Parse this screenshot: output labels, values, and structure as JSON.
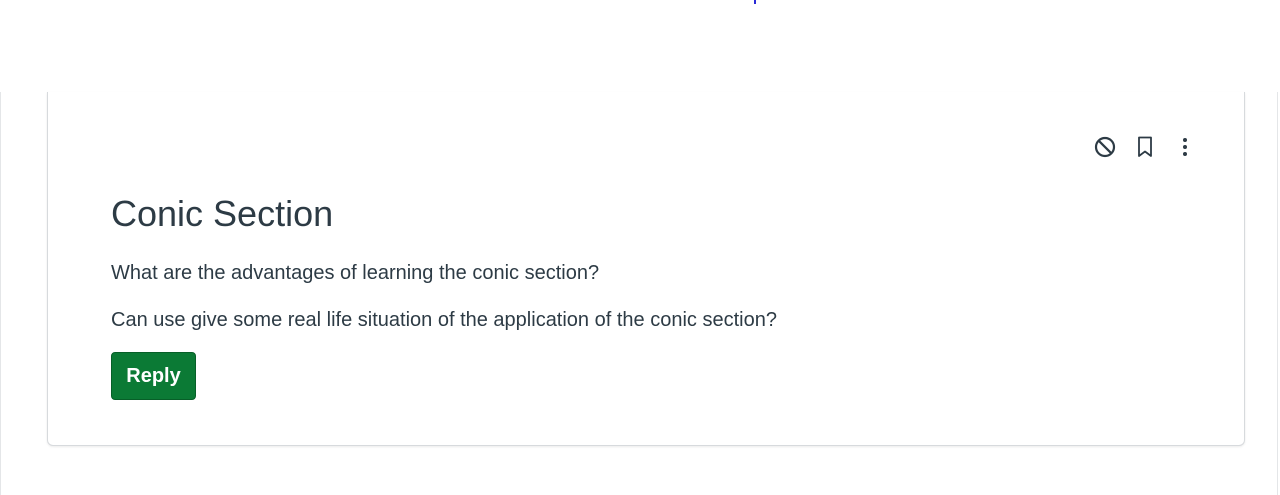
{
  "discussion": {
    "title": "Conic Section",
    "body": [
      "What are the advantages of learning the conic section?",
      "Can use give some real life situation of the application of the conic section?"
    ],
    "reply_label": "Reply"
  },
  "actions": {
    "icons": [
      "block-icon",
      "bookmark-icon",
      "more-options-icon"
    ]
  },
  "colors": {
    "accent": "#0b7a35",
    "text": "#2d3b45",
    "border": "#d7dadd"
  }
}
